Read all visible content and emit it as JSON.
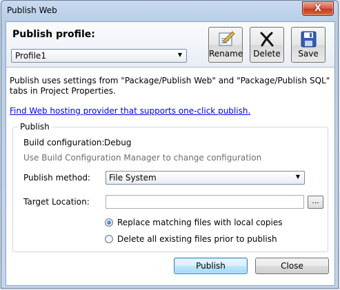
{
  "window": {
    "title": "Publish Web",
    "close_glyph": "X"
  },
  "profile": {
    "label": "Publish profile:",
    "selected": "Profile1"
  },
  "toolbar": {
    "rename_label": "Rename",
    "delete_label": "Delete",
    "save_label": "Save"
  },
  "description": "Publish uses settings from \"Package/Publish Web\" and \"Package/Publish SQL\" tabs in Project Properties.",
  "hosting_link": "Find Web hosting provider that supports one-click publish.",
  "publish_group": {
    "title": "Publish",
    "build_config_label": "Build configuration:",
    "build_config_value": "Debug",
    "build_config_hint": "Use Build Configuration Manager to change configuration",
    "method_label": "Publish method:",
    "method_value": "File System",
    "target_label": "Target Location:",
    "target_value": "",
    "browse_label": "...",
    "options": [
      {
        "label": "Replace matching files with local copies",
        "selected": true
      },
      {
        "label": "Delete all existing files prior to publish",
        "selected": false
      }
    ]
  },
  "buttons": {
    "publish_label": "Publish",
    "close_label": "Close"
  },
  "icons": {
    "rename": "rename-pencil-icon",
    "delete": "delete-x-icon",
    "save": "floppy-disk-icon"
  },
  "colors": {
    "link": "#0000ee",
    "accent": "#3c7fb1"
  }
}
